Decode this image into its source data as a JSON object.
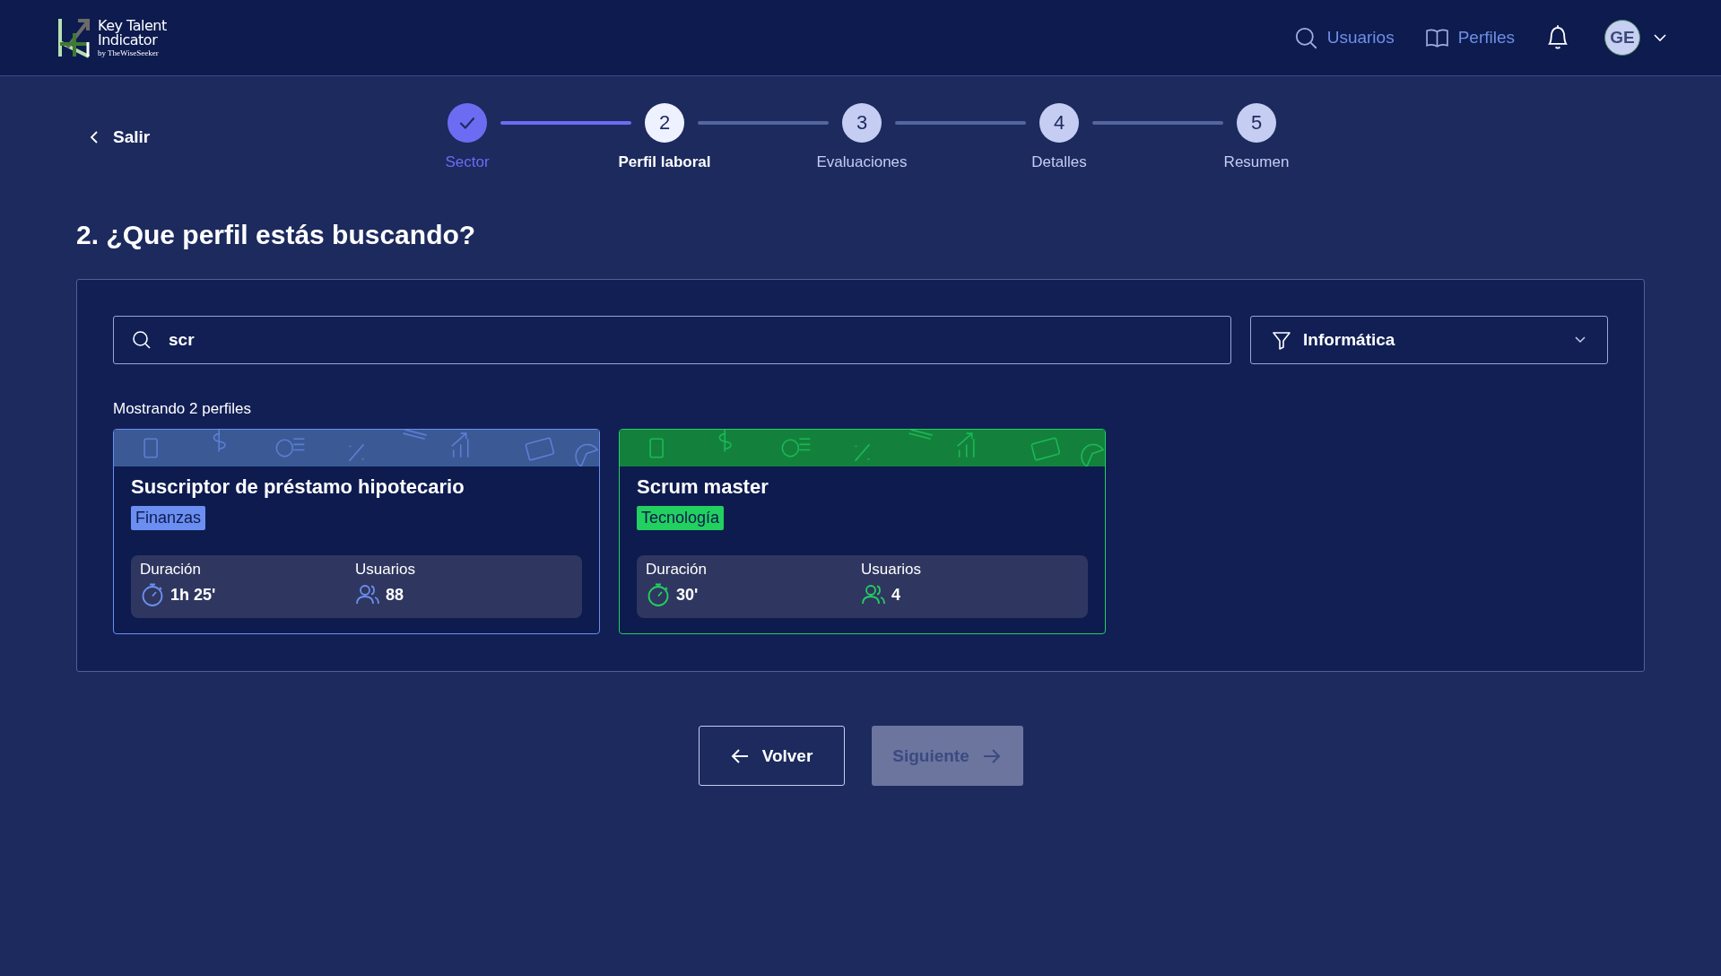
{
  "header": {
    "logo": {
      "title_line1": "Key Talent",
      "title_line2": "Indicator",
      "byline": "by TheWiseSeeker"
    },
    "nav": [
      {
        "label": "Usuarios",
        "kind": "search"
      },
      {
        "label": "Perfiles",
        "kind": "book"
      }
    ],
    "avatar": {
      "initials": "GE"
    }
  },
  "exit_link": "Salir",
  "steps": [
    {
      "label": "Sector",
      "done": true,
      "selected": false
    },
    {
      "number": "2",
      "label": "Perfil laboral",
      "done": false,
      "selected": true
    },
    {
      "number": "3",
      "label": "Evaluaciones",
      "done": false,
      "selected": false
    },
    {
      "number": "4",
      "label": "Detalles",
      "done": false,
      "selected": false
    },
    {
      "number": "5",
      "label": "Resumen",
      "done": false,
      "selected": false
    }
  ],
  "heading": "2. ¿Que perfil estás buscando?",
  "search": {
    "value": "scr"
  },
  "filter": {
    "value": "Informática"
  },
  "result_count": "Mostrando 2 perfiles",
  "profiles": [
    {
      "title": "Suscriptor de préstamo hipotecario",
      "tag": "Finanzas",
      "color": "#6b8ff0",
      "duration_label": "Duración",
      "duration": "1h 25'",
      "users_label": "Usuarios",
      "users": "88"
    },
    {
      "title": "Scrum master",
      "tag": "Tecnología",
      "color": "#22d060",
      "users_label": "Usuarios",
      "duration_label": "Duración",
      "duration": "30'",
      "users": "4"
    }
  ],
  "buttons": {
    "back": {
      "label": "Volver",
      "disabled": false
    },
    "next": {
      "label": "Siguiente",
      "disabled": true
    }
  }
}
